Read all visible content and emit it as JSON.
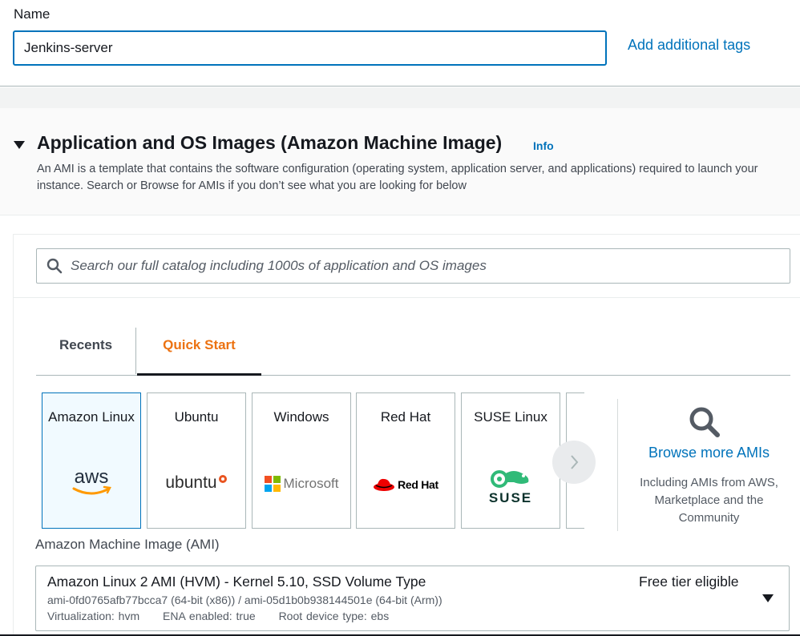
{
  "name_section": {
    "label": "Name",
    "value": "Jenkins-server",
    "add_tags_link": "Add additional tags"
  },
  "ami_section": {
    "title": "Application and OS Images (Amazon Machine Image)",
    "info_link": "Info",
    "description": "An AMI is a template that contains the software configuration (operating system, application server, and applications) required to launch your instance. Search or Browse for AMIs if you don’t see what you are looking for below",
    "search_placeholder": "Search our full catalog including 1000s of application and OS images",
    "tabs": [
      {
        "label": "Recents",
        "active": false
      },
      {
        "label": "Quick Start",
        "active": true
      }
    ],
    "os_options": [
      {
        "label": "Amazon Linux",
        "logo_text": "aws",
        "selected": true
      },
      {
        "label": "Ubuntu",
        "logo_text": "ubuntu",
        "selected": false
      },
      {
        "label": "Windows",
        "logo_text": "Microsoft",
        "selected": false
      },
      {
        "label": "Red Hat",
        "logo_text": "Red Hat",
        "selected": false
      },
      {
        "label": "SUSE Linux",
        "logo_text": "SUSE",
        "selected": false
      }
    ],
    "browse": {
      "link": "Browse more AMIs",
      "description": "Including AMIs from AWS, Marketplace and the Community"
    },
    "ami_select": {
      "label": "Amazon Machine Image (AMI)",
      "name": "Amazon Linux 2 AMI (HVM) - Kernel 5.10, SSD Volume Type",
      "ids": "ami-0fd0765afb77bcca7 (64-bit (x86)) / ami-05d1b0b938144501e (64-bit (Arm))",
      "virtualization": "Virtualization: hvm",
      "ena": "ENA enabled: true",
      "root_device": "Root device type: ebs",
      "badge": "Free tier eligible"
    }
  },
  "colors": {
    "link": "#0073bb",
    "active_tab": "#ec7211",
    "selected_card_bg": "#f1faff",
    "redhat": "#ee0000",
    "suse": "#30ba78"
  },
  "icons": [
    "caret-down-icon",
    "search-icon",
    "chevron-right-icon",
    "magnifier-icon",
    "dropdown-caret-icon"
  ]
}
